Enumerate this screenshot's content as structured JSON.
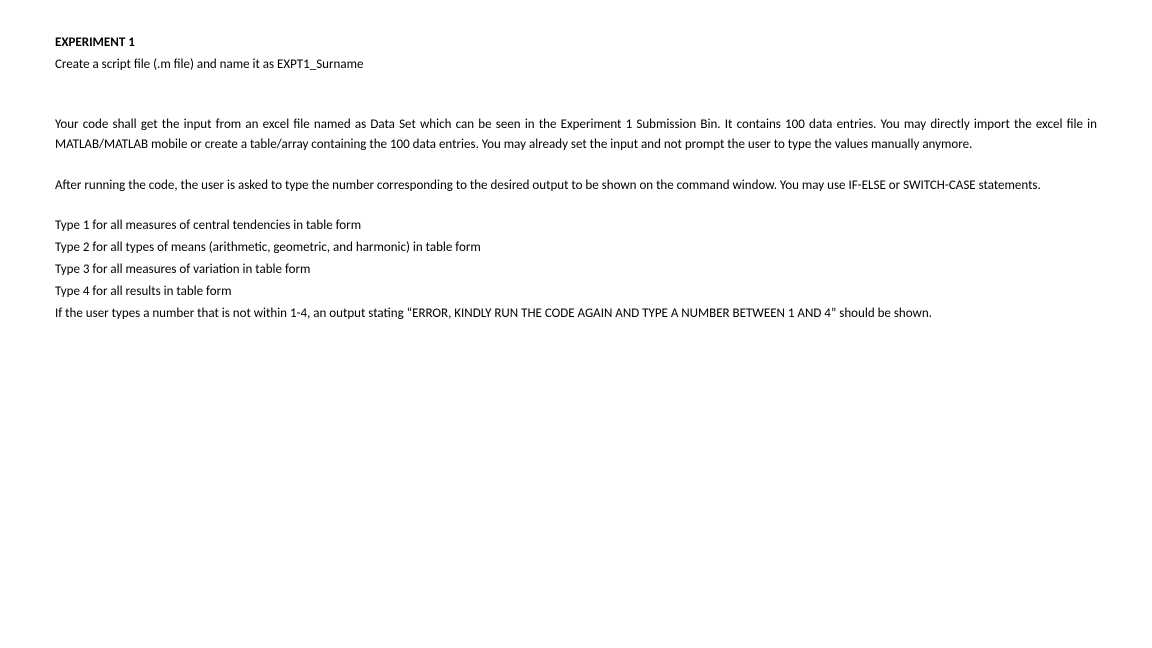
{
  "document": {
    "title": "EXPERIMENT 1",
    "intro": "Create a script file (.m file) and name it as EXPT1_Surname",
    "para1": "Your code shall get the input from an excel file named as Data Set which can be seen in the Experiment 1 Submission Bin. It contains 100 data entries. You may directly import the excel file in MATLAB/MATLAB mobile or create a table/array containing the 100 data entries. You may already set the input and not prompt the user to type the values manually anymore.",
    "para2": "After running the code, the user is asked to type the number corresponding to the desired output to be shown on the command window. You may use IF-ELSE or SWITCH-CASE statements.",
    "type1": "Type 1 for all measures of central tendencies in table form",
    "type2": "Type 2 for all types of means (arithmetic, geometric, and harmonic) in table form",
    "type3": "Type 3 for all measures of variation in table form",
    "type4": "Type 4 for all results in table form",
    "error_note": "If the user types a number that is not within 1-4, an output stating “ERROR, KINDLY RUN THE CODE AGAIN AND TYPE A NUMBER BETWEEN 1 AND 4” should be shown."
  }
}
